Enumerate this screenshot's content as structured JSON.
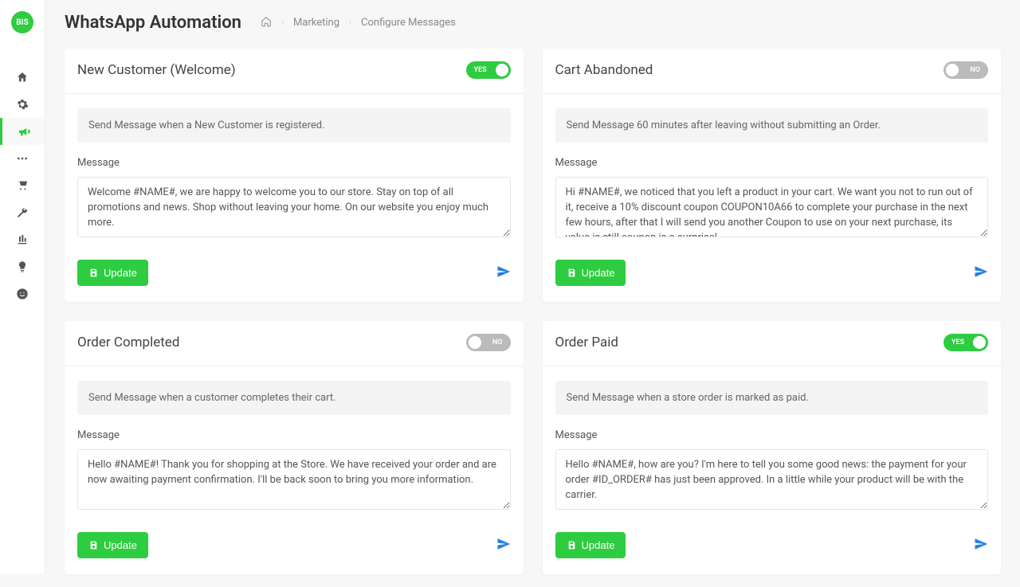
{
  "app": {
    "logo_text": "BIS"
  },
  "header": {
    "title": "WhatsApp Automation",
    "breadcrumb": {
      "l1": "Marketing",
      "l2": "Configure Messages"
    }
  },
  "toggle_labels": {
    "yes": "YES",
    "no": "NO"
  },
  "buttons": {
    "update": "Update"
  },
  "label_message": "Message",
  "cards": {
    "new_customer": {
      "title": "New Customer (Welcome)",
      "enabled": true,
      "info": "Send Message when a New Customer is registered.",
      "message": "Welcome #NAME#, we are happy to welcome you to our store. Stay on top of all promotions and news. Shop without leaving your home. On our website you enjoy much more."
    },
    "cart_abandoned": {
      "title": "Cart Abandoned",
      "enabled": false,
      "info": "Send Message 60 minutes after leaving without submitting an Order.",
      "message": "Hi #NAME#, we noticed that you left a product in your cart. We want you not to run out of it, receive a 10% discount coupon COUPON10A66 to complete your purchase in the next few hours, after that I will send you another Coupon to use on your next purchase, its value is still coupon is a surprise!"
    },
    "order_completed": {
      "title": "Order Completed",
      "enabled": false,
      "info": "Send Message when a customer completes their cart.",
      "message": "Hello #NAME#! Thank you for shopping at the Store. We have received your order and are now awaiting payment confirmation. I'll be back soon to bring you more information."
    },
    "order_paid": {
      "title": "Order Paid",
      "enabled": true,
      "info": "Send Message when a store order is marked as paid.",
      "message": "Hello #NAME#, how are you? I'm here to tell you some good news: the payment for your order #ID_ORDER# has just been approved. In a little while your product will be with the carrier."
    }
  }
}
